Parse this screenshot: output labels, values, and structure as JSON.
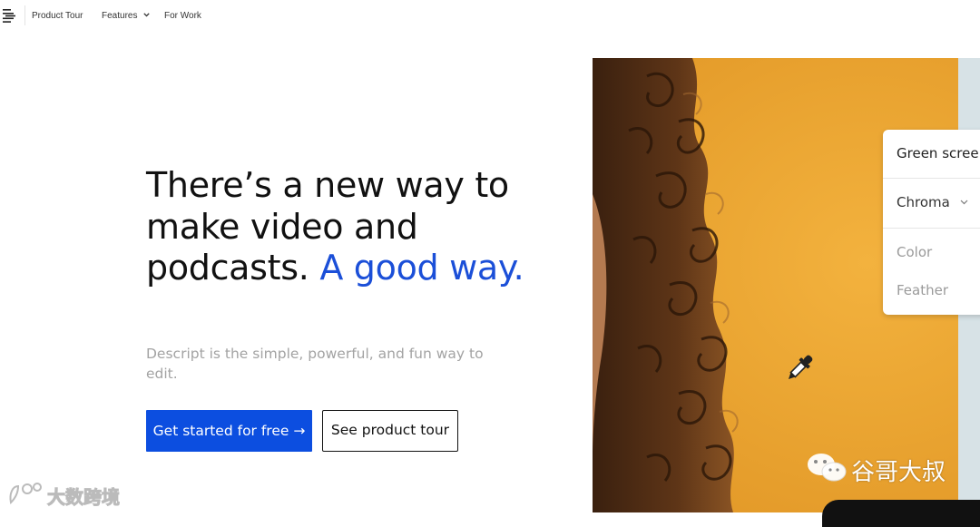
{
  "nav": {
    "logo_icon": "descript-logo-icon",
    "items": [
      {
        "label": "Product Tour"
      },
      {
        "label": "Features",
        "icon": "chevron-down-icon"
      },
      {
        "label": "For Work"
      }
    ]
  },
  "hero": {
    "headline_main": "There’s a new way to make video and podcasts.",
    "headline_accent": "A good way.",
    "subtext": "Descript is the simple, powerful, and fun way to edit.",
    "cta_primary": "Get started for free →",
    "cta_secondary": "See product tour"
  },
  "media": {
    "panel_title": "Green scree",
    "mode_select": "Chroma",
    "mode_icon": "chevron-down-icon",
    "fields": [
      "Color",
      "Feather"
    ],
    "tool_icon": "eyedropper-icon"
  },
  "watermarks": {
    "left": "大数跨境",
    "right": "谷哥大叔",
    "right_icon": "wechat-icon"
  },
  "colors": {
    "accent": "#1b4fd8",
    "primary_button": "#0c4ee0",
    "media_background": "#eaa532"
  }
}
